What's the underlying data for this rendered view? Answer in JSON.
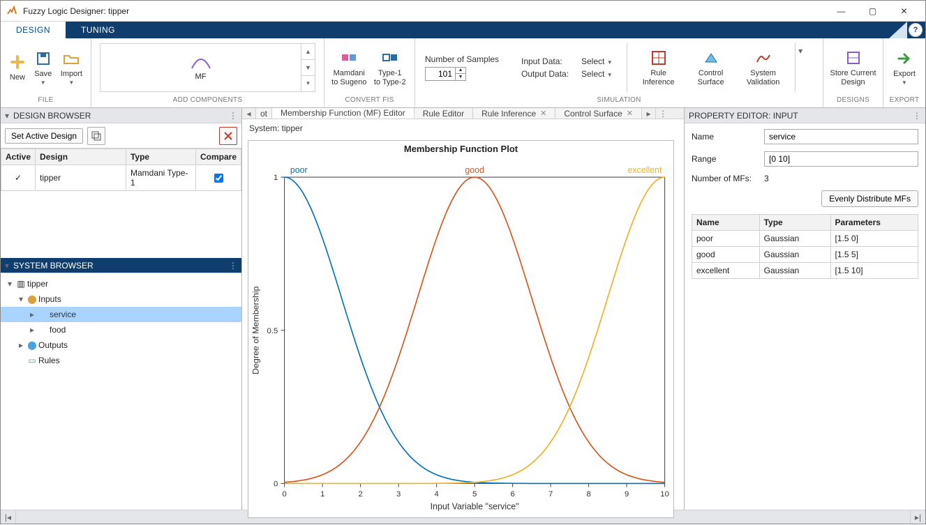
{
  "window": {
    "title": "Fuzzy Logic Designer: tipper"
  },
  "ribbon_tabs": {
    "design": "DESIGN",
    "tuning": "TUNING"
  },
  "ribbon": {
    "file": {
      "group": "FILE",
      "new": "New",
      "save": "Save",
      "import": "Import"
    },
    "add": {
      "group": "ADD COMPONENTS",
      "mf": "MF"
    },
    "convert": {
      "group": "CONVERT FIS",
      "mamdani": "Mamdani\nto Sugeno",
      "type12": "Type-1\nto Type-2"
    },
    "simulation": {
      "group": "SIMULATION",
      "num_samples_label": "Number of Samples",
      "num_samples_value": "101",
      "input_data_label": "Input Data:",
      "output_data_label": "Output Data:",
      "select": "Select",
      "rule_inference": "Rule\nInference",
      "control_surface": "Control\nSurface",
      "system_validation": "System\nValidation"
    },
    "designs": {
      "group": "DESIGNS",
      "store": "Store Current\nDesign"
    },
    "export": {
      "group": "EXPORT",
      "export": "Export"
    }
  },
  "design_browser": {
    "title": "DESIGN BROWSER",
    "set_active": "Set Active Design",
    "cols": {
      "active": "Active",
      "design": "Design",
      "type": "Type",
      "compare": "Compare"
    },
    "rows": [
      {
        "active": "✓",
        "design": "tipper",
        "type": "Mamdani Type-1",
        "compare": true
      }
    ]
  },
  "system_browser": {
    "title": "SYSTEM BROWSER",
    "root": "tipper",
    "inputs_label": "Inputs",
    "outputs_label": "Outputs",
    "rules_label": "Rules",
    "inputs": [
      "service",
      "food"
    ]
  },
  "doc_tabs": {
    "partial": "ot",
    "mf_editor": "Membership Function (MF) Editor",
    "rule_editor": "Rule Editor",
    "rule_inference": "Rule Inference",
    "control_surface": "Control Surface"
  },
  "center": {
    "system_label": "System: tipper",
    "chart_title": "Membership Function Plot",
    "xlabel": "Input Variable \"service\"",
    "ylabel": "Degree of Membership",
    "labels": {
      "poor": "poor",
      "good": "good",
      "excellent": "excellent"
    }
  },
  "property_editor": {
    "title": "PROPERTY EDITOR: INPUT",
    "name_label": "Name",
    "name_value": "service",
    "range_label": "Range",
    "range_value": "[0 10]",
    "num_mfs_label": "Number of MFs:",
    "num_mfs_value": "3",
    "dist_btn": "Evenly Distribute MFs",
    "cols": {
      "name": "Name",
      "type": "Type",
      "params": "Parameters"
    },
    "rows": [
      {
        "name": "poor",
        "type": "Gaussian",
        "params": "[1.5 0]"
      },
      {
        "name": "good",
        "type": "Gaussian",
        "params": "[1.5 5]"
      },
      {
        "name": "excellent",
        "type": "Gaussian",
        "params": "[1.5 10]"
      }
    ]
  },
  "chart_data": {
    "type": "line",
    "title": "Membership Function Plot",
    "xlabel": "Input Variable \"service\"",
    "ylabel": "Degree of Membership",
    "xlim": [
      0,
      10
    ],
    "ylim": [
      0,
      1
    ],
    "xticks": [
      0,
      1,
      2,
      3,
      4,
      5,
      6,
      7,
      8,
      9,
      10
    ],
    "yticks": [
      0,
      0.5,
      1
    ],
    "series": [
      {
        "name": "poor",
        "color": "#0072bd",
        "function": "gaussmf",
        "sigma": 1.5,
        "mean": 0
      },
      {
        "name": "good",
        "color": "#d95319",
        "function": "gaussmf",
        "sigma": 1.5,
        "mean": 5
      },
      {
        "name": "excellent",
        "color": "#edb120",
        "function": "gaussmf",
        "sigma": 1.5,
        "mean": 10
      }
    ]
  }
}
